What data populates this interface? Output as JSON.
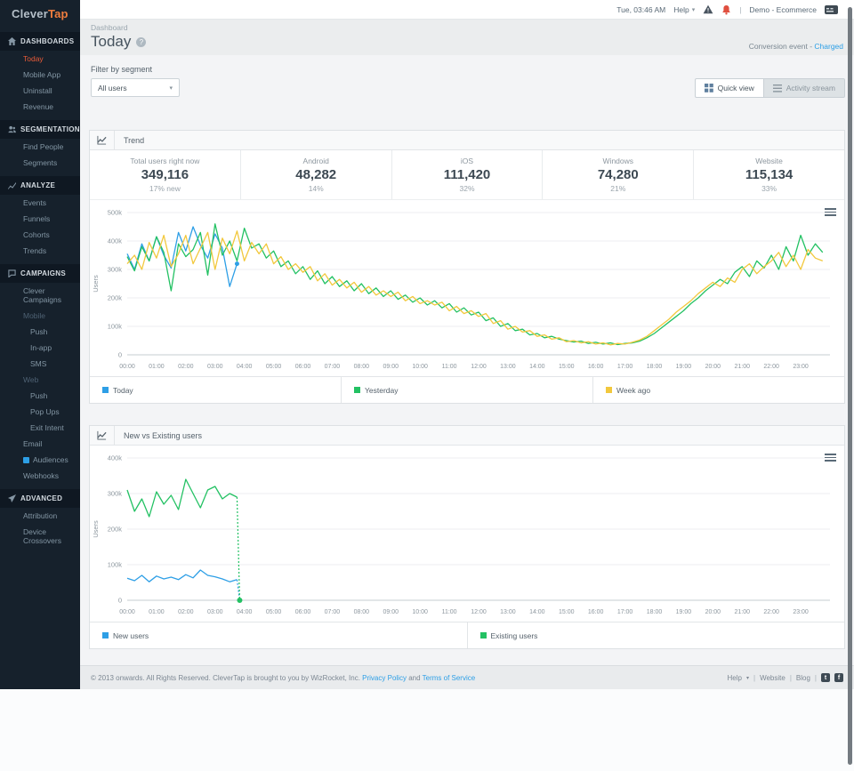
{
  "top_bar": {
    "datetime": "Tue, 03:46 AM",
    "help_label": "Help",
    "account_label": "Demo - Ecommerce"
  },
  "icons": {
    "caret_down": "▾",
    "pipe": "|",
    "stats_caret": "›",
    "question": "?",
    "twitter_glyph": "t",
    "facebook_glyph": "f"
  },
  "sidebar": {
    "logo_part1": "Clever",
    "logo_part2": "Tap",
    "sections": [
      {
        "label": "DASHBOARDS",
        "icon": "home-icon",
        "items": [
          {
            "label": "Today",
            "active": true
          },
          {
            "label": "Mobile App"
          },
          {
            "label": "Uninstall"
          },
          {
            "label": "Revenue"
          }
        ]
      },
      {
        "label": "SEGMENTATION",
        "icon": "users-icon",
        "items": [
          {
            "label": "Find People"
          },
          {
            "label": "Segments"
          }
        ]
      },
      {
        "label": "ANALYZE",
        "icon": "trend-icon",
        "items": [
          {
            "label": "Events"
          },
          {
            "label": "Funnels"
          },
          {
            "label": "Cohorts"
          },
          {
            "label": "Trends"
          }
        ]
      },
      {
        "label": "CAMPAIGNS",
        "icon": "chat-icon",
        "items": [
          {
            "label": "Clever Campaigns"
          },
          {
            "label": "Mobile",
            "muted": true
          },
          {
            "label": "Push",
            "indent": true
          },
          {
            "label": "In-app",
            "indent": true
          },
          {
            "label": "SMS",
            "indent": true
          },
          {
            "label": "Web",
            "muted": true
          },
          {
            "label": "Push",
            "indent": true
          },
          {
            "label": "Pop Ups",
            "indent": true
          },
          {
            "label": "Exit Intent",
            "indent": true
          },
          {
            "label": "Email"
          },
          {
            "label": "Audiences",
            "badge": true
          },
          {
            "label": "Webhooks"
          }
        ]
      },
      {
        "label": "ADVANCED",
        "icon": "plane-icon",
        "items": [
          {
            "label": "Attribution"
          },
          {
            "label": "Device Crossovers"
          }
        ]
      }
    ]
  },
  "header": {
    "breadcrumb": "Dashboard",
    "title": "Today",
    "conversion_label": "Conversion event - ",
    "conversion_value": "Charged"
  },
  "filter": {
    "label": "Filter by segment",
    "value": "All users"
  },
  "view_toggle": {
    "quick": "Quick view",
    "activity": "Activity stream"
  },
  "trend_panel": {
    "stats": [
      {
        "label": "Total users right now",
        "value": "349,116",
        "sub": "17% new"
      },
      {
        "label": "Android",
        "value": "48,282",
        "sub": "14%"
      },
      {
        "label": "iOS",
        "value": "111,420",
        "sub": "32%"
      },
      {
        "label": "Windows",
        "value": "74,280",
        "sub": "21%"
      },
      {
        "label": "Website",
        "value": "115,134",
        "sub": "33%"
      }
    ]
  },
  "footer": {
    "copyright_prefix": "© 2013 onwards. All Rights Reserved. CleverTap is brought to you by WizRocket, Inc.",
    "privacy": "Privacy Policy",
    "and_word": "and",
    "terms": "Terms of Service",
    "help": "Help",
    "website": "Website",
    "blog": "Blog"
  },
  "colors": {
    "accent_orange": "#ef7d3e",
    "active_item": "#e95b38",
    "link_blue": "#2d9fe6",
    "series_blue": "#2e9fe6",
    "series_green": "#23c163",
    "series_yellow": "#f2c83d",
    "sidebar_bg": "#16212c",
    "bell_red": "#e04f3f"
  },
  "chart_data": [
    {
      "type": "line",
      "name": "trend-chart",
      "title": "Trend",
      "ylabel": "Users",
      "units": "values in thousands of users",
      "x_hours": 24,
      "ylim": [
        0,
        500
      ],
      "grid": true,
      "legend_position": "bottom",
      "y_ticks": [
        {
          "v": 0,
          "label": "0"
        },
        {
          "v": 100,
          "label": "100k"
        },
        {
          "v": 200,
          "label": "200k"
        },
        {
          "v": 300,
          "label": "300k"
        },
        {
          "v": 400,
          "label": "400k"
        },
        {
          "v": 500,
          "label": "500k"
        }
      ],
      "x_labels": [
        "00:00",
        "01:00",
        "02:00",
        "03:00",
        "04:00",
        "05:00",
        "06:00",
        "07:00",
        "08:00",
        "09:00",
        "10:00",
        "11:00",
        "12:00",
        "13:00",
        "14:00",
        "15:00",
        "16:00",
        "17:00",
        "18:00",
        "19:00",
        "20:00",
        "21:00",
        "22:00",
        "23:00"
      ],
      "series": [
        {
          "name": "Today",
          "color": "#2e9fe6",
          "step": 0.25,
          "marker": "end",
          "values": [
            355,
            300,
            390,
            330,
            415,
            350,
            305,
            430,
            365,
            450,
            385,
            340,
            425,
            375,
            240,
            320
          ]
        },
        {
          "name": "Yesterday",
          "color": "#23c163",
          "step": 0.25,
          "values": [
            345,
            295,
            380,
            330,
            415,
            360,
            225,
            390,
            345,
            370,
            430,
            280,
            460,
            350,
            400,
            330,
            445,
            375,
            390,
            340,
            365,
            310,
            330,
            285,
            310,
            265,
            295,
            250,
            275,
            240,
            260,
            225,
            250,
            215,
            235,
            205,
            225,
            195,
            210,
            185,
            200,
            175,
            190,
            165,
            180,
            150,
            165,
            140,
            150,
            120,
            130,
            100,
            110,
            85,
            90,
            70,
            75,
            60,
            65,
            55,
            50,
            45,
            48,
            40,
            44,
            38,
            42,
            36,
            40,
            42,
            48,
            60,
            75,
            95,
            115,
            135,
            155,
            180,
            200,
            225,
            245,
            265,
            250,
            290,
            310,
            275,
            330,
            305,
            350,
            300,
            380,
            330,
            420,
            350,
            390,
            360
          ]
        },
        {
          "name": "Week ago",
          "color": "#f2c83d",
          "step": 0.25,
          "values": [
            320,
            350,
            300,
            395,
            340,
            420,
            310,
            355,
            420,
            320,
            375,
            430,
            300,
            410,
            355,
            435,
            330,
            395,
            355,
            390,
            320,
            345,
            300,
            320,
            290,
            310,
            260,
            285,
            245,
            265,
            235,
            255,
            220,
            240,
            210,
            225,
            205,
            220,
            190,
            205,
            180,
            190,
            175,
            185,
            155,
            170,
            145,
            155,
            135,
            145,
            110,
            120,
            90,
            100,
            80,
            85,
            65,
            70,
            55,
            60,
            46,
            50,
            42,
            46,
            38,
            42,
            35,
            40,
            38,
            44,
            52,
            65,
            85,
            105,
            125,
            150,
            170,
            190,
            215,
            235,
            255,
            240,
            270,
            255,
            300,
            320,
            285,
            310,
            330,
            360,
            310,
            350,
            300,
            370,
            340,
            330
          ]
        }
      ]
    },
    {
      "type": "line",
      "name": "new-vs-existing-chart",
      "title": "New vs Existing users",
      "ylabel": "Users",
      "units": "values in thousands of users",
      "x_hours": 24,
      "ylim": [
        0,
        400
      ],
      "grid": true,
      "legend_position": "bottom",
      "y_ticks": [
        {
          "v": 0,
          "label": "0"
        },
        {
          "v": 100,
          "label": "100k"
        },
        {
          "v": 200,
          "label": "200k"
        },
        {
          "v": 300,
          "label": "300k"
        },
        {
          "v": 400,
          "label": "400k"
        }
      ],
      "x_labels": [
        "00:00",
        "01:00",
        "02:00",
        "03:00",
        "04:00",
        "05:00",
        "06:00",
        "07:00",
        "08:00",
        "09:00",
        "10:00",
        "11:00",
        "12:00",
        "13:00",
        "14:00",
        "15:00",
        "16:00",
        "17:00",
        "18:00",
        "19:00",
        "20:00",
        "21:00",
        "22:00",
        "23:00"
      ],
      "series": [
        {
          "name": "New users",
          "color": "#2e9fe6",
          "step": 0.25,
          "end_drop": true,
          "values": [
            62,
            55,
            70,
            52,
            68,
            60,
            65,
            58,
            72,
            63,
            85,
            70,
            66,
            60,
            52,
            58
          ]
        },
        {
          "name": "Existing users",
          "color": "#23c163",
          "step": 0.25,
          "end_drop": true,
          "end_marker_bottom": true,
          "values": [
            310,
            250,
            285,
            235,
            305,
            270,
            295,
            255,
            340,
            300,
            260,
            310,
            320,
            285,
            300,
            290
          ]
        }
      ]
    }
  ]
}
